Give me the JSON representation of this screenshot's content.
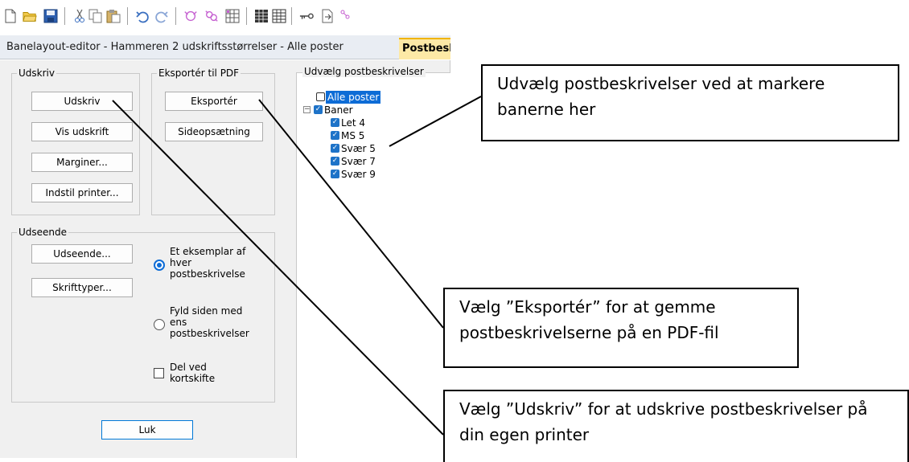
{
  "toolbar": {
    "icons": [
      "new-file-icon",
      "open-folder-icon",
      "save-icon",
      "cut-icon",
      "copy-icon",
      "paste-icon",
      "undo-icon",
      "redo-icon",
      "control-icon",
      "controls-icon",
      "grid-icon",
      "table-icon",
      "table-grid-icon",
      "key-icon",
      "export-icon",
      "course-icon"
    ]
  },
  "tabs": {
    "title": "Banelayout-editor - Hammeren 2 udskriftsstørrelser - Alle poster",
    "active": "Postbeskrivelser"
  },
  "dialog": {
    "print_group": {
      "legend": "Udskriv",
      "buttons": [
        "Udskriv",
        "Vis udskrift",
        "Marginer...",
        "Indstil printer..."
      ]
    },
    "export_group": {
      "legend": "Eksportér til PDF",
      "buttons": [
        "Eksportér",
        "Sideopsætning"
      ]
    },
    "appearance_group": {
      "legend": "Udseende",
      "buttons": [
        "Udseende...",
        "Skrifttyper..."
      ],
      "options": [
        {
          "label": "Et eksemplar af hver postbeskrivelse",
          "lines": [
            "Et eksemplar af",
            "hver",
            "postbeskrivelse"
          ],
          "selected": true
        },
        {
          "label": "Fyld siden med ens postbeskrivelser",
          "lines": [
            "Fyld siden med",
            "ens",
            "postbeskrivelser"
          ],
          "selected": false
        }
      ],
      "checkbox": {
        "lines": [
          "Del ved",
          "kortskifte"
        ],
        "checked": false
      }
    },
    "close_button": "Luk",
    "tree": {
      "legend": "Udvælg postbeskrivelser",
      "items": [
        {
          "label": "Alle poster",
          "checked": false,
          "level": 0,
          "selected": true
        },
        {
          "label": "Baner",
          "checked": true,
          "level": 0,
          "expander": "−"
        },
        {
          "label": "Let 4",
          "checked": true,
          "level": 1
        },
        {
          "label": "MS 5",
          "checked": true,
          "level": 1
        },
        {
          "label": "Svær 5",
          "checked": true,
          "level": 1
        },
        {
          "label": "Svær 7",
          "checked": true,
          "level": 1
        },
        {
          "label": "Svær 9",
          "checked": true,
          "level": 1
        }
      ]
    }
  },
  "callouts": {
    "tree_hint": "Udvælg postbeskrivelser ved at markere banerne her",
    "export_hint": "Vælg ”Eksportér” for at gemme postbeskrivelserne på en PDF-fil",
    "print_hint": "Vælg ”Udskriv” for at udskrive postbeskrivelser på din egen printer"
  }
}
